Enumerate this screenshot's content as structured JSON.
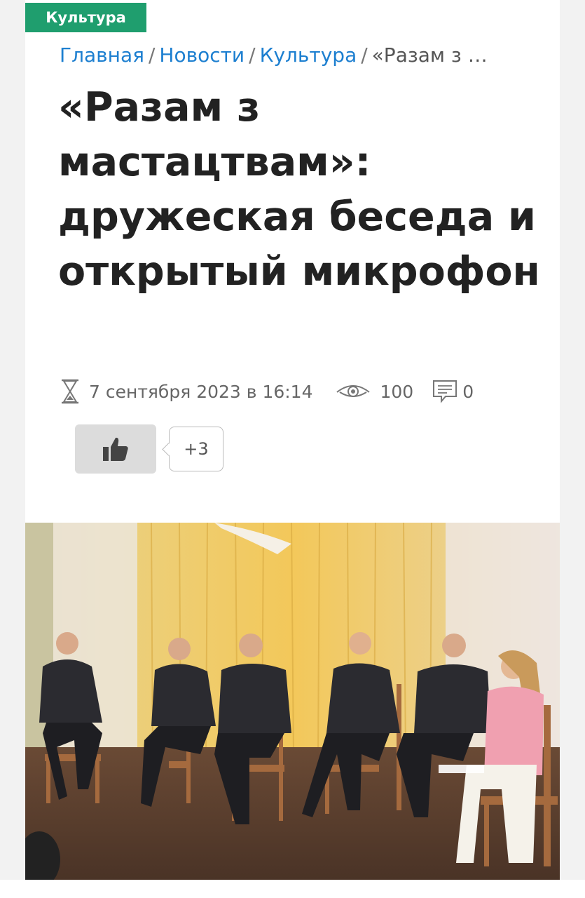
{
  "category": {
    "label": "Культура",
    "color": "#1f9e6e"
  },
  "breadcrumb": {
    "items": [
      "Главная",
      "Новости",
      "Культура"
    ],
    "current": "«Разам з …"
  },
  "article": {
    "title": "«Разам з мастацтвам»: дружеская беседа и открытый микрофон",
    "date": "7 сентября 2023 в 16:14",
    "views": "100",
    "comments": "0",
    "likes": "+3"
  },
  "icons": {
    "date": "hourglass-icon",
    "views": "eye-icon",
    "comments": "comment-icon",
    "like": "thumbs-up-icon"
  },
  "colors": {
    "link": "#1d7fd0",
    "title": "#222222",
    "meta": "#666666"
  }
}
